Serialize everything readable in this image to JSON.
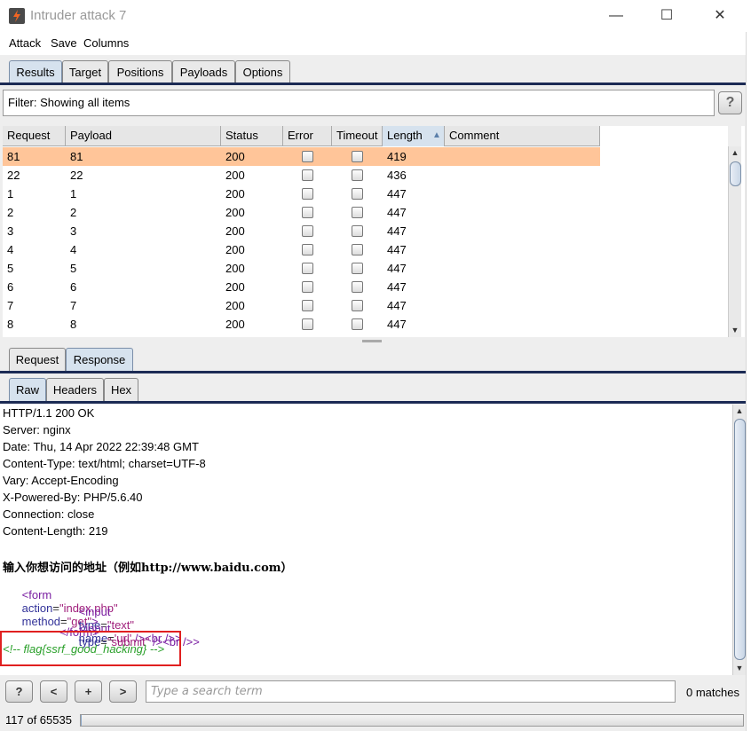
{
  "window": {
    "title": "Intruder attack 7",
    "minimize": "—",
    "maximize": "☐",
    "close": "✕"
  },
  "menu": [
    "Attack",
    "Save",
    "Columns"
  ],
  "top_tabs": [
    {
      "label": "Results",
      "active": true
    },
    {
      "label": "Target",
      "active": false
    },
    {
      "label": "Positions",
      "active": false
    },
    {
      "label": "Payloads",
      "active": false
    },
    {
      "label": "Options",
      "active": false
    }
  ],
  "filter": {
    "text": "Filter: Showing all items",
    "help": "?"
  },
  "table": {
    "columns": [
      "Request",
      "Payload",
      "Status",
      "Error",
      "Timeout",
      "Length",
      "Comment"
    ],
    "sort_indicator": "▲",
    "rows": [
      {
        "request": "81",
        "payload": "81",
        "status": "200",
        "length": "419",
        "selected": true
      },
      {
        "request": "22",
        "payload": "22",
        "status": "200",
        "length": "436",
        "selected": false
      },
      {
        "request": "1",
        "payload": "1",
        "status": "200",
        "length": "447",
        "selected": false
      },
      {
        "request": "2",
        "payload": "2",
        "status": "200",
        "length": "447",
        "selected": false
      },
      {
        "request": "3",
        "payload": "3",
        "status": "200",
        "length": "447",
        "selected": false
      },
      {
        "request": "4",
        "payload": "4",
        "status": "200",
        "length": "447",
        "selected": false
      },
      {
        "request": "5",
        "payload": "5",
        "status": "200",
        "length": "447",
        "selected": false
      },
      {
        "request": "6",
        "payload": "6",
        "status": "200",
        "length": "447",
        "selected": false
      },
      {
        "request": "7",
        "payload": "7",
        "status": "200",
        "length": "447",
        "selected": false
      },
      {
        "request": "8",
        "payload": "8",
        "status": "200",
        "length": "447",
        "selected": false
      }
    ]
  },
  "detail_tabs": [
    {
      "label": "Request",
      "active": false
    },
    {
      "label": "Response",
      "active": true
    }
  ],
  "view_tabs": [
    {
      "label": "Raw",
      "active": true
    },
    {
      "label": "Headers",
      "active": false
    },
    {
      "label": "Hex",
      "active": false
    }
  ],
  "response": {
    "headers": [
      "HTTP/1.1 200 OK",
      "Server: nginx",
      "Date: Thu, 14 Apr 2022 22:39:48 GMT",
      "Content-Type: text/html; charset=UTF-8",
      "Vary: Accept-Encoding",
      "X-Powered-By: PHP/5.6.40",
      "Connection: close",
      "Content-Length: 219"
    ],
    "body_heading": "输入你想访问的地址（例如http://www.baidu.com）",
    "form_open": {
      "tag": "form",
      "action_attr": "action",
      "action_val": "\"index.php\"",
      "method_attr": "method",
      "method_val": "\"get\""
    },
    "input1": {
      "tag": "input",
      "type_attr": "type",
      "type_val": "\"text\"",
      "name_attr": "name",
      "name_val": "'url'",
      "tail": " /><",
      "br": "br",
      "end": " />"
    },
    "input2": {
      "tag": "input",
      "type_attr": "type",
      "type_val": "\"submit\"",
      "tail": " /><",
      "br": "br",
      "end": " />"
    },
    "form_close": "</form>",
    "comment": "<!-- flag{ssrf_good_hacking} -->"
  },
  "search": {
    "help": "?",
    "prev": "<",
    "add": "+",
    "next": ">",
    "placeholder": "Type a search term",
    "matches": "0 matches"
  },
  "status": {
    "text": "117 of 65535",
    "progress": 0.0018
  }
}
